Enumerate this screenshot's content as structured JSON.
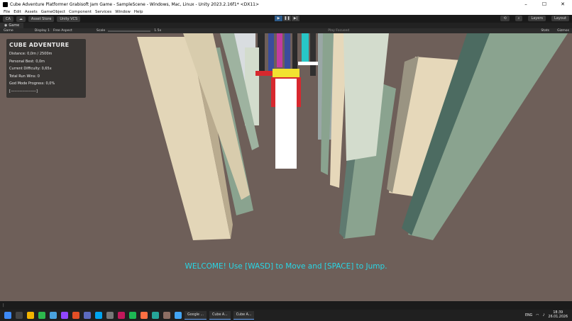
{
  "window": {
    "title": "Cube Adventure Platformer Grabisoft Jam Game - SampleScene - Windows, Mac, Linux - Unity 2023.2.16f1* <DX11>",
    "controls": [
      "–",
      "☐",
      "✕"
    ]
  },
  "menu": [
    "File",
    "Edit",
    "Assets",
    "GameObject",
    "Component",
    "Services",
    "Window",
    "Help"
  ],
  "toolbar": {
    "account": "CA",
    "asset_store": "Asset Store",
    "vcs": "Unity VCS",
    "layers": "Layers",
    "layout": "Layout"
  },
  "tabs": {
    "game": "Game"
  },
  "gamebar": {
    "mode": "Game",
    "display": "Display 1",
    "aspect": "Free Aspect",
    "scale_label": "Scale",
    "scale_value": "1.5x",
    "play_focused": "Play Focused",
    "stats": "Stats",
    "gizmos": "Gizmos"
  },
  "hud": {
    "title": "CUBE ADVENTURE",
    "distance": "Distance: 0,0m / 2500m",
    "best": "Personal Best: 0,0m",
    "difficulty": "Current Difficulty: 0,65x",
    "wins": "Total Run Wins: 0",
    "god_mode": "God Mode Progress: 0,0%",
    "bar": "[--------------------]"
  },
  "welcome_text": "WELCOME! Use [WASD] to Move and [SPACE] to Jump.",
  "taskbar": {
    "apps": [
      "Google ...",
      "Cube A...",
      "Cube A..."
    ],
    "lang": "ENG",
    "time": "18:39",
    "date": "26.01.2026"
  },
  "colors": {
    "floor": "#6e5f59",
    "cream_pillar": "#e3d6b8",
    "green_pillar": "#8aa38f",
    "dark_green_pillar": "#4c6b61",
    "welcome": "#28d7e6"
  }
}
